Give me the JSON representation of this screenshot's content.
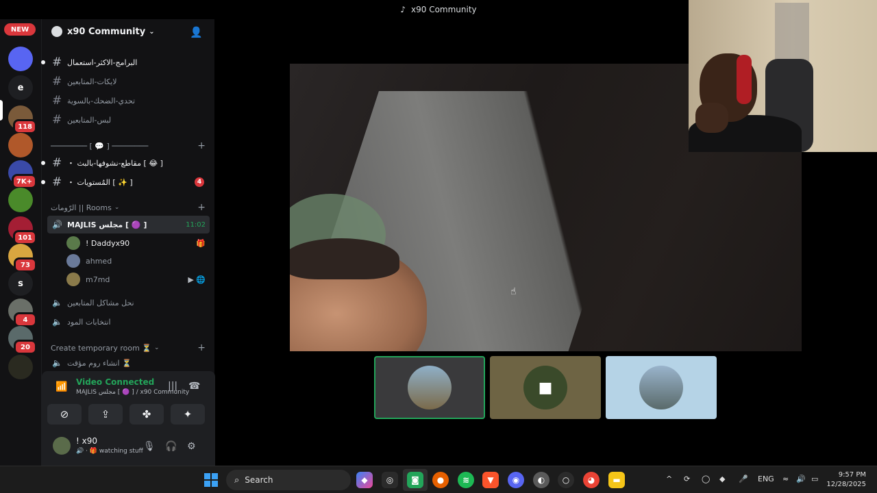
{
  "window": {
    "title": "x90 Community"
  },
  "rail": {
    "new_badge": "NEW",
    "servers": [
      {
        "name": "home",
        "initial": "",
        "color": "#5865f2",
        "badge": ""
      },
      {
        "name": "e",
        "initial": "e",
        "color": "#1e1f22",
        "badge": ""
      },
      {
        "name": "server-3",
        "initial": "",
        "color": "#7a5a3a",
        "badge": "118"
      },
      {
        "name": "server-4",
        "initial": "",
        "color": "#b0582a",
        "badge": ""
      },
      {
        "name": "server-5",
        "initial": "",
        "color": "#3a4aa8",
        "badge": "7K+"
      },
      {
        "name": "server-6",
        "initial": "",
        "color": "#4a8a2a",
        "badge": ""
      },
      {
        "name": "server-7",
        "initial": "",
        "color": "#a41e34",
        "badge": "101"
      },
      {
        "name": "server-8",
        "initial": "",
        "color": "#d9a640",
        "badge": "73"
      },
      {
        "name": "s",
        "initial": "s",
        "color": "#1e1f22",
        "badge": ""
      },
      {
        "name": "server-10",
        "initial": "",
        "color": "#6a6f68",
        "badge": "4"
      },
      {
        "name": "server-11",
        "initial": "",
        "color": "#5a6a6a",
        "badge": "20"
      },
      {
        "name": "server-12",
        "initial": "",
        "color": "#2a2a20",
        "badge": ""
      }
    ]
  },
  "guild": {
    "name": "x90 Community"
  },
  "channels": [
    {
      "name": "البرامج-الاكثر-استعمال",
      "bright": true,
      "unread": true
    },
    {
      "name": "لايكات-المتابعين",
      "bright": false,
      "unread": false
    },
    {
      "name": "تحدي-الضحك-بالسوية",
      "bright": false,
      "unread": false
    },
    {
      "name": "لبس-المتابعين",
      "bright": false,
      "unread": false
    }
  ],
  "category_divider": "──────── [ 💬 ] ────────",
  "channels2": [
    {
      "name": "・ مقاطع-نشوفها-بالبث [ 😂 ]",
      "bright": true,
      "unread": true,
      "badge": ""
    },
    {
      "name": "・ المُستويات [ ✨ ]",
      "bright": true,
      "unread": true,
      "badge": "4"
    }
  ],
  "rooms_category": "الرّومات || Rooms",
  "voice_channel": {
    "name": "MAJLIS مجلس [ 🟣 ]",
    "time": "11:02"
  },
  "voice_users": [
    {
      "name": "! Daddyx90",
      "color": "#5a7a4a",
      "bright": true,
      "icons": "🎁"
    },
    {
      "name": "ahmed",
      "color": "#6a7a9a",
      "bright": false,
      "icons": ""
    },
    {
      "name": "m7md",
      "color": "#8a7a4a",
      "bright": false,
      "icons": "▶ 🌐"
    }
  ],
  "voice_channels_extra": [
    {
      "name": "نحل مشاكل المتابعين"
    },
    {
      "name": "انتخابات المود"
    }
  ],
  "temp_category": "Create temporary room ⏳",
  "temp_channel": "انشاء روم مؤقت ⏳",
  "voice_panel": {
    "status": "Video Connected",
    "location": "MAJLIS مجلس [ 🟣 ] / x90 Community"
  },
  "user_panel": {
    "name": "! x90",
    "status": "watching stuff"
  },
  "taskbar": {
    "search_label": "Search",
    "language": "ENG",
    "time": "9:57 PM",
    "date": "12/28/2025"
  }
}
